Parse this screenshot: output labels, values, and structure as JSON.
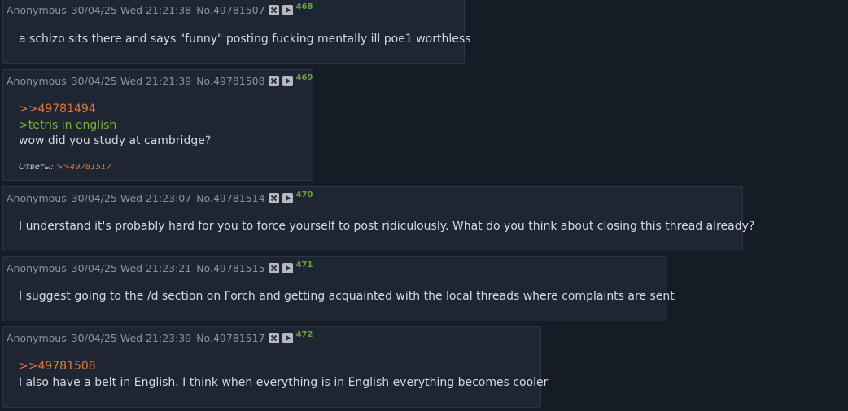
{
  "posts": [
    {
      "name": "Anonymous",
      "date": "30/04/25 Wed 21:21:38",
      "number": "No.49781507",
      "index": "468",
      "lines": [
        {
          "type": "text",
          "text": "a schizo sits there and says \"funny\" posting fucking mentally ill poe1 worthless"
        }
      ]
    },
    {
      "name": "Anonymous",
      "date": "30/04/25 Wed 21:21:39",
      "number": "No.49781508",
      "index": "469",
      "lines": [
        {
          "type": "reflink",
          "text": ">>49781494"
        },
        {
          "type": "quote",
          "text": ">tetris in english"
        },
        {
          "type": "text",
          "text": "wow did you study at cambridge?"
        }
      ],
      "replies_label": "Ответы:",
      "replies": [
        ">>49781517"
      ]
    },
    {
      "name": "Anonymous",
      "date": "30/04/25 Wed 21:23:07",
      "number": "No.49781514",
      "index": "470",
      "lines": [
        {
          "type": "text",
          "text": "I understand it's probably hard for you to force yourself to post ridiculously. What do you think about closing this thread already?"
        }
      ]
    },
    {
      "name": "Anonymous",
      "date": "30/04/25 Wed 21:23:21",
      "number": "No.49781515",
      "index": "471",
      "lines": [
        {
          "type": "text",
          "text": "I suggest going to the /d section on Forch and getting acquainted with the local threads where complaints are sent"
        }
      ]
    },
    {
      "name": "Anonymous",
      "date": "30/04/25 Wed 21:23:39",
      "number": "No.49781517",
      "index": "472",
      "lines": [
        {
          "type": "reflink",
          "text": ">>49781508"
        },
        {
          "type": "text",
          "text": "I also have a belt in English. I think when everything is in English everything becomes cooler"
        }
      ]
    }
  ],
  "icons": {
    "hide": "close-icon",
    "play": "play-icon"
  },
  "colors": {
    "background": "#161c26",
    "post_background": "#1e2634",
    "reflink": "#e2743a",
    "greentext": "#7ab234",
    "post_index": "#6a9f3d"
  }
}
